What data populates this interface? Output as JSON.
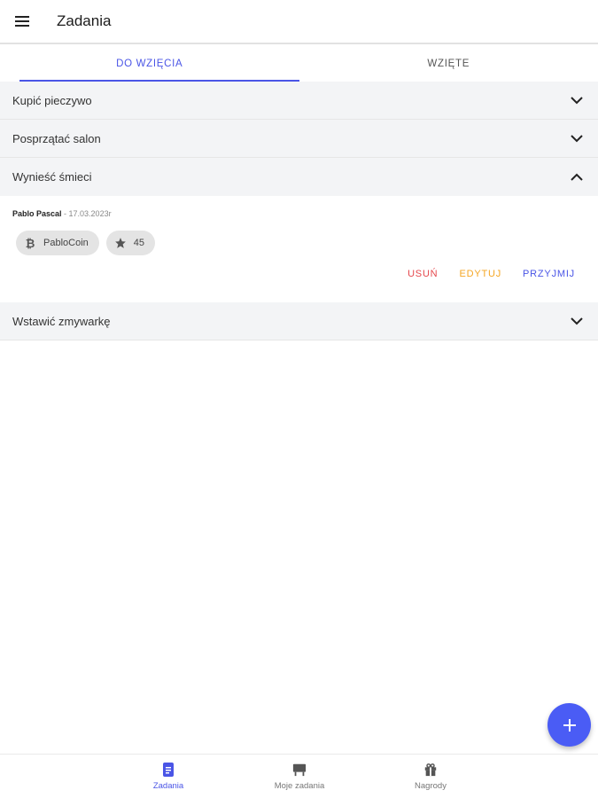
{
  "appbar": {
    "title": "Zadania",
    "menu_icon": "hamburger-menu-icon"
  },
  "tabs": [
    {
      "label": "DO WZIĘCIA",
      "active": true
    },
    {
      "label": "WZIĘTE",
      "active": false
    }
  ],
  "tasks": [
    {
      "title": "Kupić pieczywo",
      "expanded": false
    },
    {
      "title": "Posprzątać salon",
      "expanded": false
    },
    {
      "title": "Wynieść śmieci",
      "expanded": true,
      "author": "Pablo Pascal",
      "date": " - 17.03.2023r",
      "chips": [
        {
          "icon": "bitcoin-icon",
          "label": "PabloCoin"
        },
        {
          "icon": "star-icon",
          "label": "45"
        }
      ],
      "actions": {
        "delete": "USUŃ",
        "edit": "EDYTUJ",
        "accept": "PRZYJMIJ"
      }
    },
    {
      "title": "Wstawić zmywarkę",
      "expanded": false
    }
  ],
  "fab": {
    "icon": "plus-icon"
  },
  "bottom_nav": [
    {
      "label": "Zadania",
      "icon": "clipboard-icon",
      "active": true
    },
    {
      "label": "Moje zadania",
      "icon": "board-icon",
      "active": false
    },
    {
      "label": "Nagrody",
      "icon": "gift-icon",
      "active": false
    }
  ],
  "colors": {
    "accent": "#4a55e6",
    "delete": "#e5484d",
    "edit": "#f5a623"
  }
}
